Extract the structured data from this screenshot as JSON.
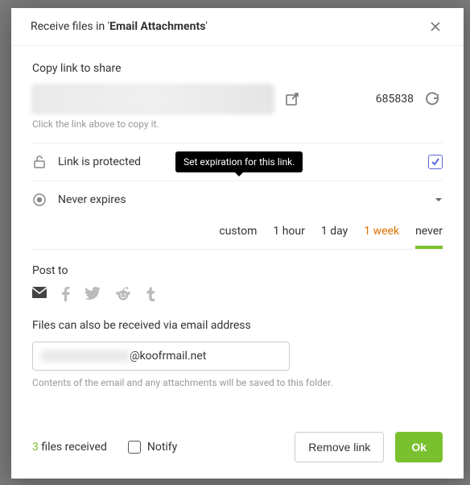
{
  "modal": {
    "title_prefix": "Receive files in '",
    "folder_name": "Email Attachments",
    "title_suffix": "'"
  },
  "share": {
    "label": "Copy link to share",
    "link_value": "",
    "helper": "Click the link above to copy it.",
    "code": "685838"
  },
  "protect": {
    "text": "Link is protected",
    "tooltip": "Set expiration for this link.",
    "checked": true
  },
  "expire": {
    "text": "Never expires",
    "options": [
      "custom",
      "1 hour",
      "1 day",
      "1 week",
      "never"
    ],
    "active": "never",
    "warn": "1 week"
  },
  "post": {
    "label": "Post to"
  },
  "email": {
    "label": "Files can also be received via email address",
    "domain": "@koofrmail.net",
    "helper": "Contents of the email and any attachments will be saved to this folder."
  },
  "footer": {
    "files_count": "3",
    "files_label": " files received",
    "notify": "Notify",
    "remove": "Remove link",
    "ok": "Ok"
  }
}
